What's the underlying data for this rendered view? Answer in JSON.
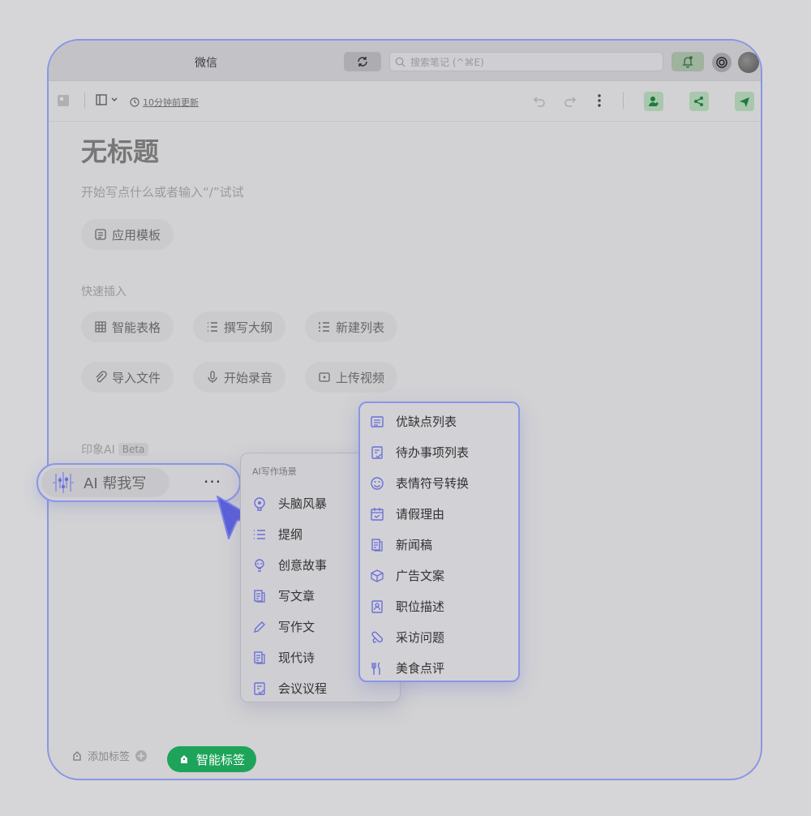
{
  "window": {
    "title": "微信",
    "search_placeholder": "搜索笔记 (^⌘E)",
    "update_text": "10分钟前更新"
  },
  "document": {
    "title": "无标题",
    "placeholder": "开始写点什么或者输入“/”试试",
    "template_label": "应用模板"
  },
  "quick_insert": {
    "label": "快速插入",
    "items": [
      "智能表格",
      "撰写大纲",
      "新建列表",
      "导入文件",
      "开始录音",
      "上传视频"
    ]
  },
  "ai_section": {
    "label": "印象AI",
    "beta": "Beta",
    "button_label": "AI 帮我写",
    "more": "···"
  },
  "scenes_menu": {
    "header": "AI写作场景",
    "items": [
      "头脑风暴",
      "提纲",
      "创意故事",
      "写文章",
      "写作文",
      "现代诗",
      "会议议程"
    ]
  },
  "submenu": {
    "items": [
      "优缺点列表",
      "待办事项列表",
      "表情符号转换",
      "请假理由",
      "新闻稿",
      "广告文案",
      "职位描述",
      "采访问题",
      "美食点评"
    ]
  },
  "footer": {
    "add_tag": "添加标签",
    "smart_tag": "智能标签"
  },
  "colors": {
    "accent": "#6b6fd8",
    "green": "#1ea45a",
    "highlight_border": "#8b95e6"
  }
}
